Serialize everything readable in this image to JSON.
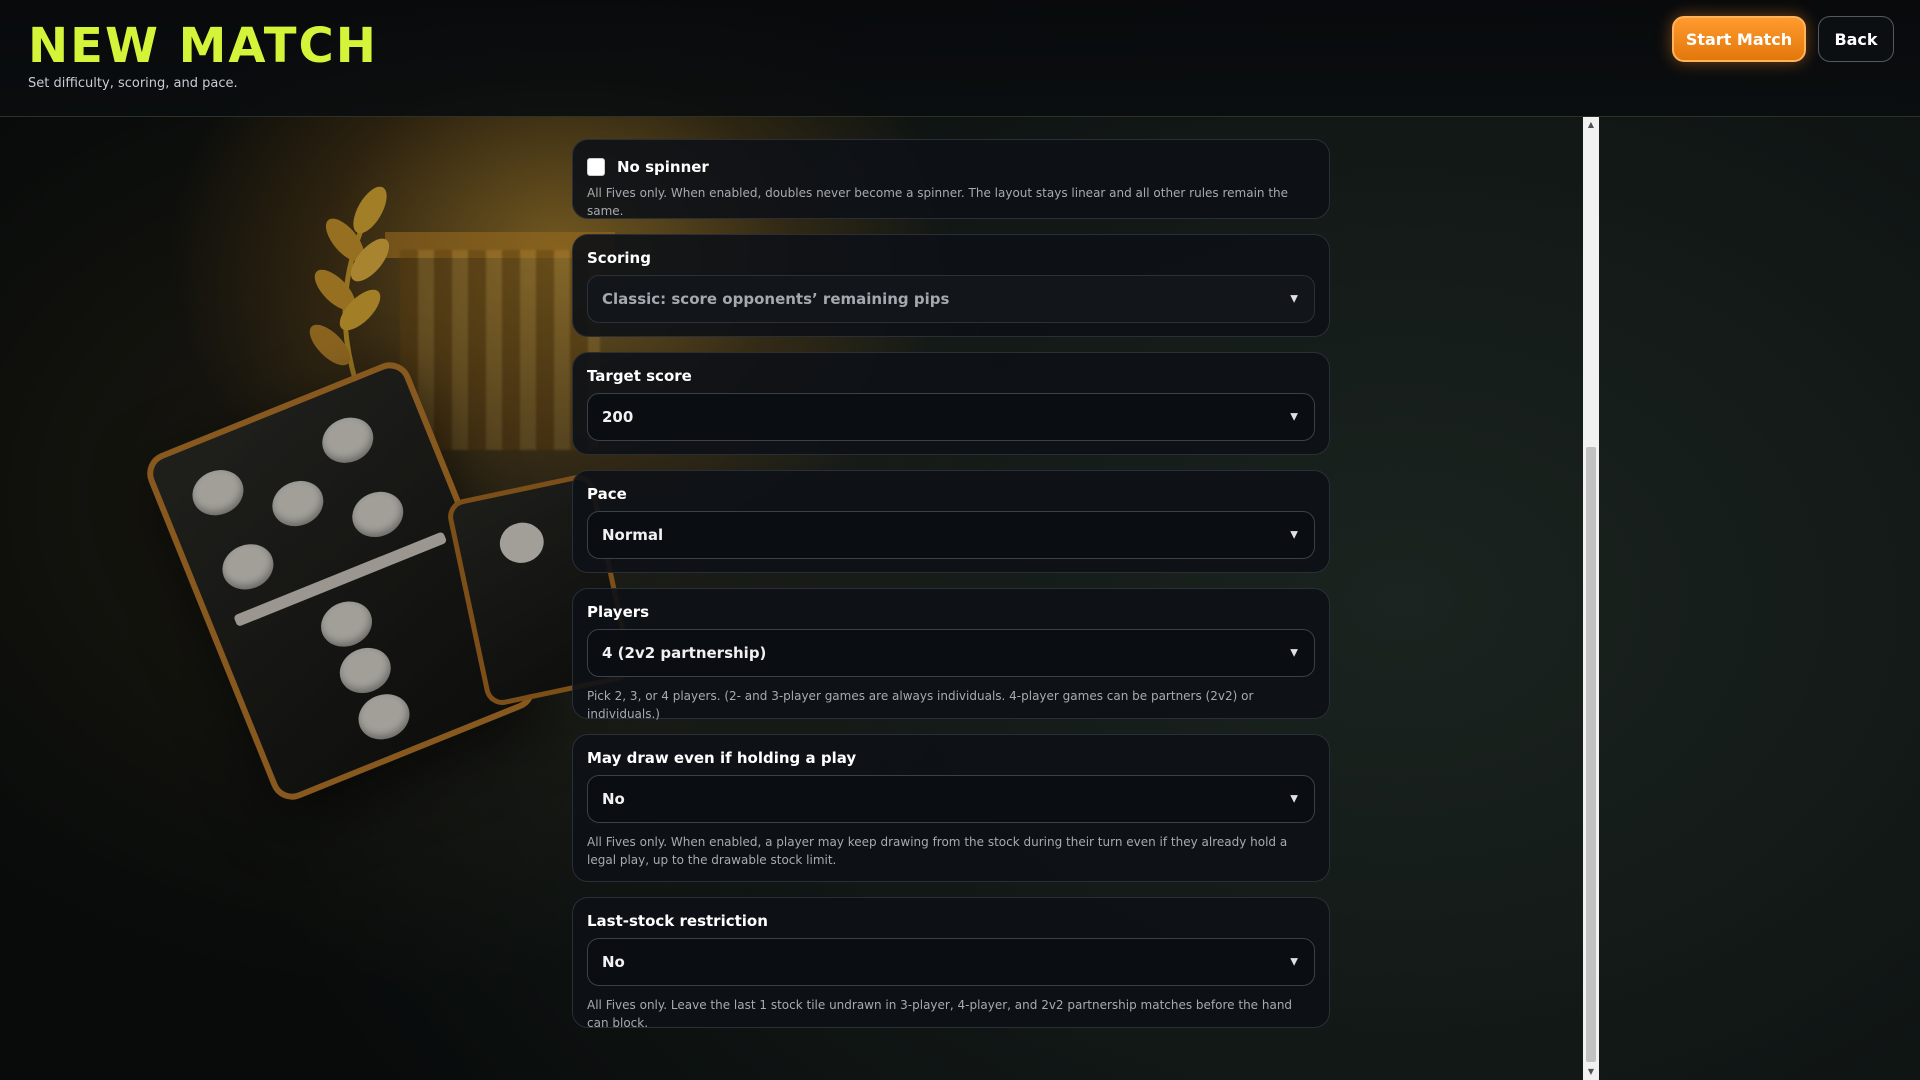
{
  "header": {
    "title": "NEW MATCH",
    "subtitle": "Set difficulty, scoring, and pace.",
    "start_button": "Start Match",
    "back_button": "Back"
  },
  "settings": {
    "no_spinner": {
      "label": "No spinner",
      "checked": false,
      "help": "All Fives only. When enabled, doubles never become a spinner. The layout stays linear and all other rules remain the same."
    },
    "scoring": {
      "label": "Scoring",
      "value": "Classic: score opponents’ remaining pips"
    },
    "target_score": {
      "label": "Target score",
      "value": "200"
    },
    "pace": {
      "label": "Pace",
      "value": "Normal"
    },
    "players": {
      "label": "Players",
      "value": "4 (2v2 partnership)",
      "help": "Pick 2, 3, or 4 players. (2- and 3-player games are always individuals. 4-player games can be partners (2v2) or individuals.)"
    },
    "draw_even_holding": {
      "label": "May draw even if holding a play",
      "value": "No",
      "help": "All Fives only. When enabled, a player may keep drawing from the stock during their turn even if they already hold a legal play, up to the drawable stock limit."
    },
    "last_stock": {
      "label": "Last-stock restriction",
      "value": "No",
      "help": "All Fives only. Leave the last 1 stock tile undrawn in 3-player, 4-player, and 2v2 partnership matches before the hand can block."
    }
  },
  "icons": {
    "dropdown": "chevron-down-icon",
    "scroll_up": "scroll-up-arrow-icon",
    "scroll_down": "scroll-down-arrow-icon"
  },
  "colors": {
    "title": "#d4f43a",
    "start_button": "#f08a1c",
    "card_bg": "#0d1116"
  }
}
